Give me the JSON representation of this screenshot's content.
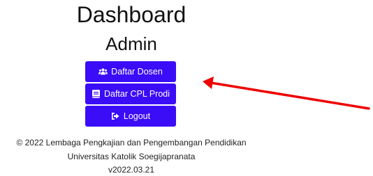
{
  "header": {
    "title": "Dashboard",
    "subtitle": "Admin"
  },
  "menu": {
    "items": [
      {
        "label": "Daftar Dosen",
        "icon": "users-icon"
      },
      {
        "label": "Daftar CPL Prodi",
        "icon": "book-icon"
      },
      {
        "label": "Logout",
        "icon": "sign-out-icon"
      }
    ]
  },
  "footer": {
    "line1": "© 2022 Lembaga Pengkajian dan Pengembangan Pendidikan",
    "line2": "Universitas Katolik Soegijapranata",
    "line3": "v2022.03.21"
  },
  "colors": {
    "button_bg": "#3b0cf7",
    "button_text": "#ffffff",
    "annotation_arrow": "#ee0000"
  }
}
